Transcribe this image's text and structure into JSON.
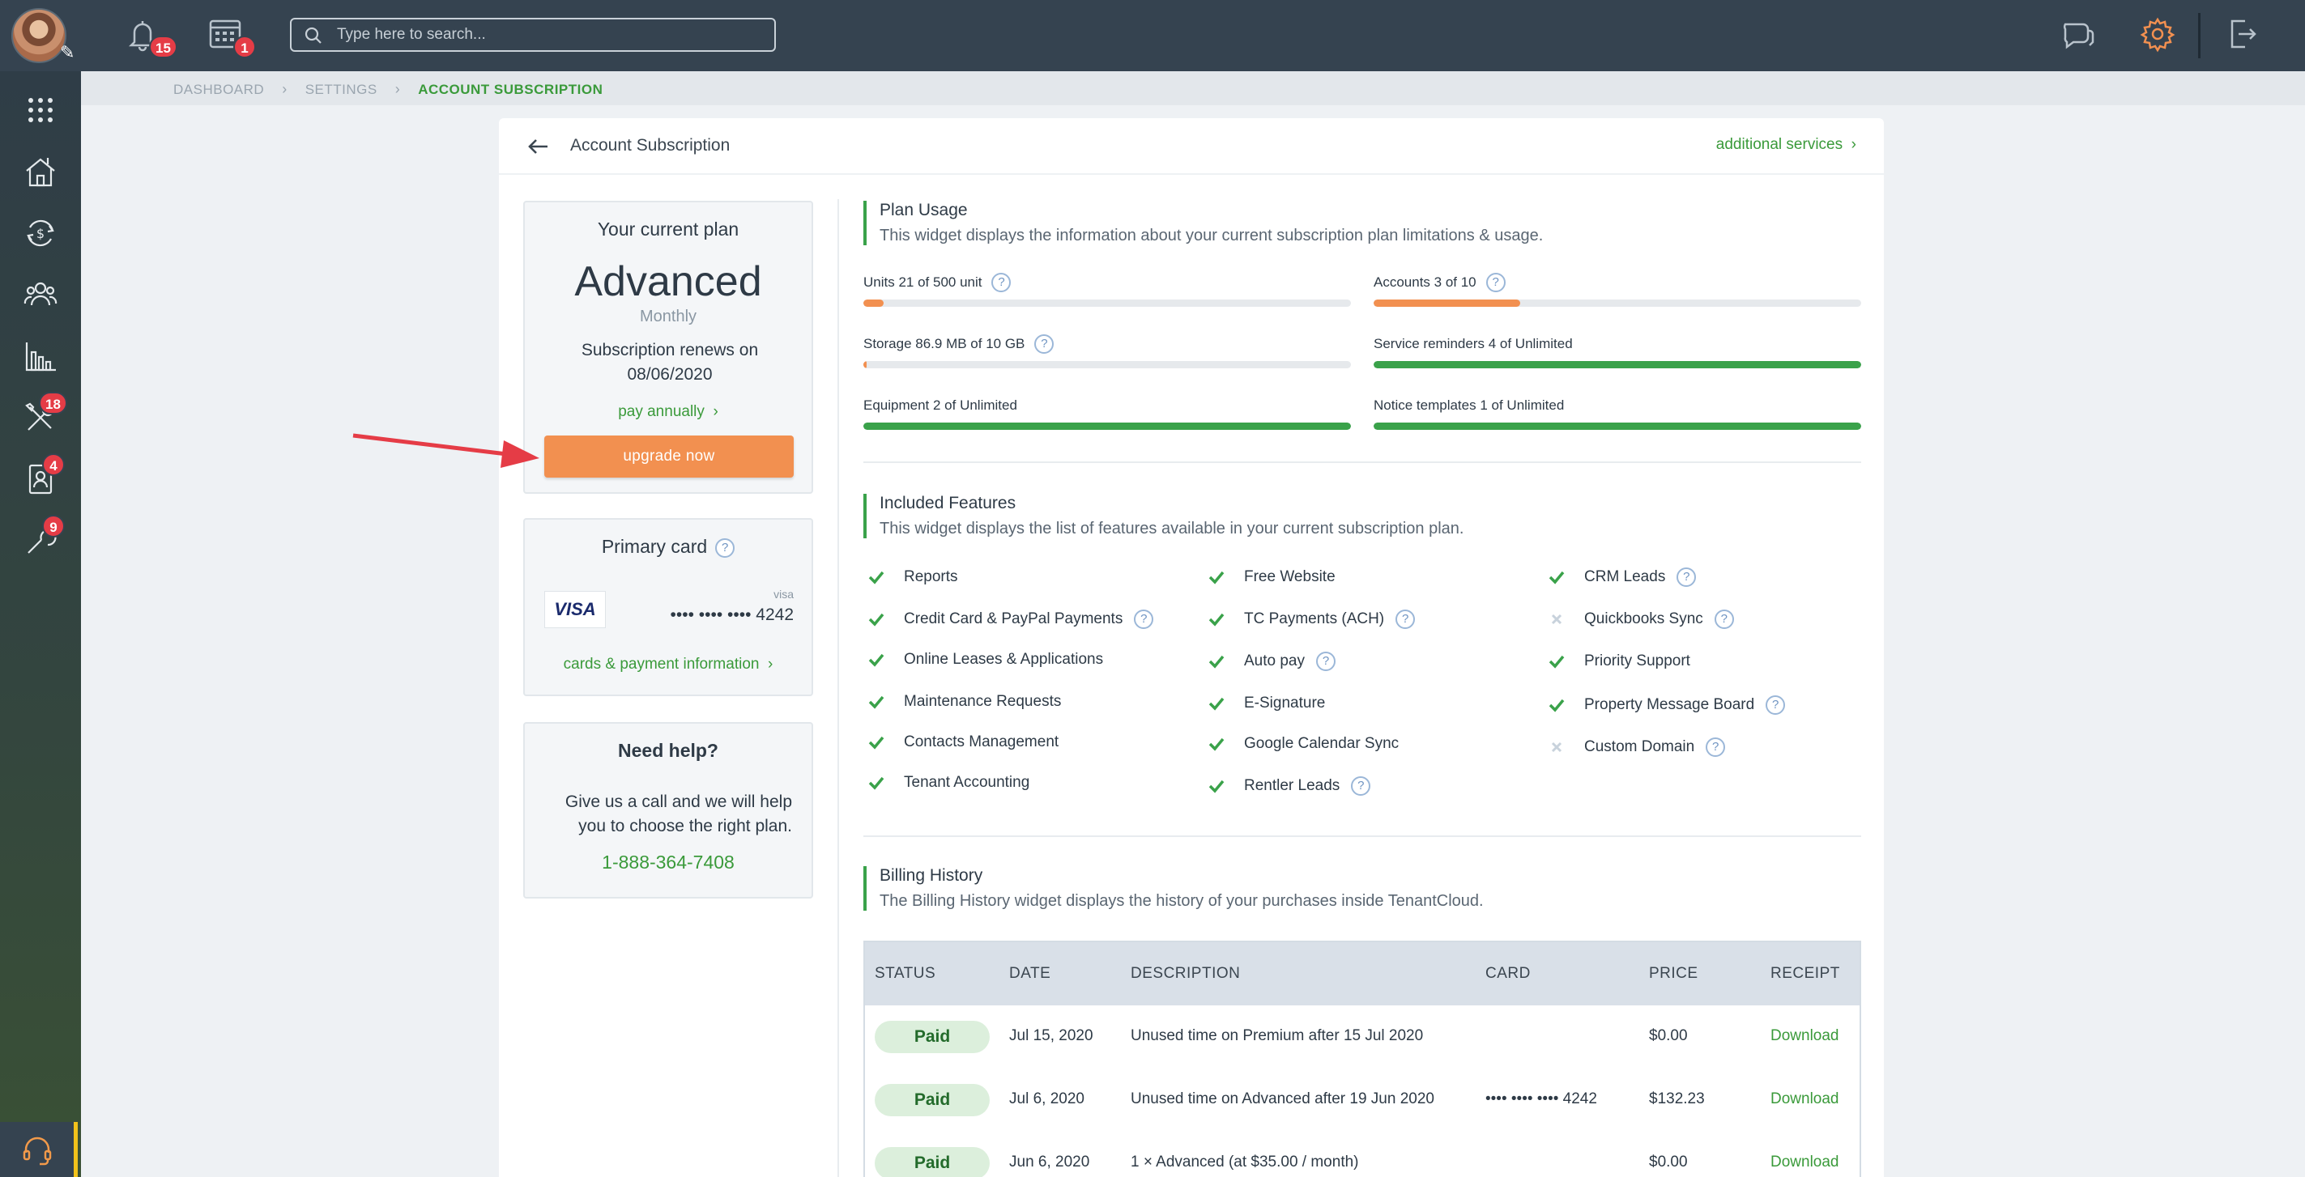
{
  "topbar": {
    "notifications_count": "15",
    "calendar_count": "1",
    "search_placeholder": "Type here to search..."
  },
  "sidebar": {
    "badges": {
      "tools": "18",
      "contacts": "4",
      "services": "9"
    }
  },
  "breadcrumb": {
    "items": [
      "DASHBOARD",
      "SETTINGS",
      "ACCOUNT SUBSCRIPTION"
    ]
  },
  "page": {
    "title": "Account Subscription",
    "additional_services": "additional services"
  },
  "current_plan": {
    "label": "Your current plan",
    "plan_name": "Advanced",
    "period": "Monthly",
    "renewal_line1": "Subscription renews on",
    "renewal_line2": "08/06/2020",
    "pay_annually": "pay annually",
    "upgrade_button": "upgrade now"
  },
  "primary_card": {
    "label": "Primary card",
    "brand_logo": "VISA",
    "brand_small": "visa",
    "number": "•••• •••• •••• 4242",
    "link": "cards & payment information"
  },
  "help": {
    "title": "Need help?",
    "text": "Give us a call and we will help you to choose the right plan.",
    "phone": "1-888-364-7408"
  },
  "plan_usage": {
    "title": "Plan Usage",
    "description": "This widget displays the information about your current subscription plan limitations & usage.",
    "items": [
      {
        "label": "Units 21 of 500 unit",
        "help": true,
        "fill_fraction": 0.042,
        "color": "#f29050"
      },
      {
        "label": "Accounts 3 of 10",
        "help": true,
        "fill_fraction": 0.3,
        "color": "#f29050"
      },
      {
        "label": "Storage 86.9 MB of 10 GB",
        "help": true,
        "fill_fraction": 0.0085,
        "color": "#f29050"
      },
      {
        "label": "Service reminders 4 of Unlimited",
        "help": false,
        "fill_fraction": 1.0,
        "color": "#3aa24a"
      },
      {
        "label": "Equipment 2 of Unlimited",
        "help": false,
        "fill_fraction": 1.0,
        "color": "#3aa24a"
      },
      {
        "label": "Notice templates 1 of Unlimited",
        "help": false,
        "fill_fraction": 1.0,
        "color": "#3aa24a"
      }
    ]
  },
  "features": {
    "title": "Included Features",
    "description": "This widget displays the list of features available in your current subscription plan.",
    "col1": [
      {
        "label": "Reports",
        "included": true,
        "help": false
      },
      {
        "label": "Credit Card & PayPal Payments",
        "included": true,
        "help": true
      },
      {
        "label": "Online Leases & Applications",
        "included": true,
        "help": false
      },
      {
        "label": "Maintenance Requests",
        "included": true,
        "help": false
      },
      {
        "label": "Contacts Management",
        "included": true,
        "help": false
      },
      {
        "label": "Tenant Accounting",
        "included": true,
        "help": false
      }
    ],
    "col2": [
      {
        "label": "Free Website",
        "included": true,
        "help": false
      },
      {
        "label": "TC Payments (ACH)",
        "included": true,
        "help": true
      },
      {
        "label": "Auto pay",
        "included": true,
        "help": true
      },
      {
        "label": "E-Signature",
        "included": true,
        "help": false
      },
      {
        "label": "Google Calendar Sync",
        "included": true,
        "help": false
      },
      {
        "label": "Rentler Leads",
        "included": true,
        "help": true
      }
    ],
    "col3": [
      {
        "label": "CRM Leads",
        "included": true,
        "help": true
      },
      {
        "label": "Quickbooks Sync",
        "included": false,
        "help": true
      },
      {
        "label": "Priority Support",
        "included": true,
        "help": false
      },
      {
        "label": "Property Message Board",
        "included": true,
        "help": true
      },
      {
        "label": "Custom Domain",
        "included": false,
        "help": true
      }
    ]
  },
  "billing": {
    "title": "Billing History",
    "description": "The Billing History widget displays the history of your purchases inside TenantCloud.",
    "headers": [
      "STATUS",
      "DATE",
      "DESCRIPTION",
      "CARD",
      "PRICE",
      "RECEIPT"
    ],
    "rows": [
      {
        "status": "Paid",
        "date": "Jul 15, 2020",
        "description": "Unused time on Premium after 15 Jul 2020",
        "card": "",
        "price": "$0.00",
        "receipt": "Download"
      },
      {
        "status": "Paid",
        "date": "Jul 6, 2020",
        "description": "Unused time on Advanced after 19 Jun 2020",
        "card": "•••• •••• •••• 4242",
        "price": "$132.23",
        "receipt": "Download"
      },
      {
        "status": "Paid",
        "date": "Jun 6, 2020",
        "description": "1 × Advanced (at $35.00 / month)",
        "card": "",
        "price": "$0.00",
        "receipt": "Download"
      }
    ]
  },
  "colors": {
    "accent_green": "#3a9a3a",
    "accent_orange": "#f29050",
    "topbar": "#354350",
    "annotation_arrow": "#e53c46"
  }
}
